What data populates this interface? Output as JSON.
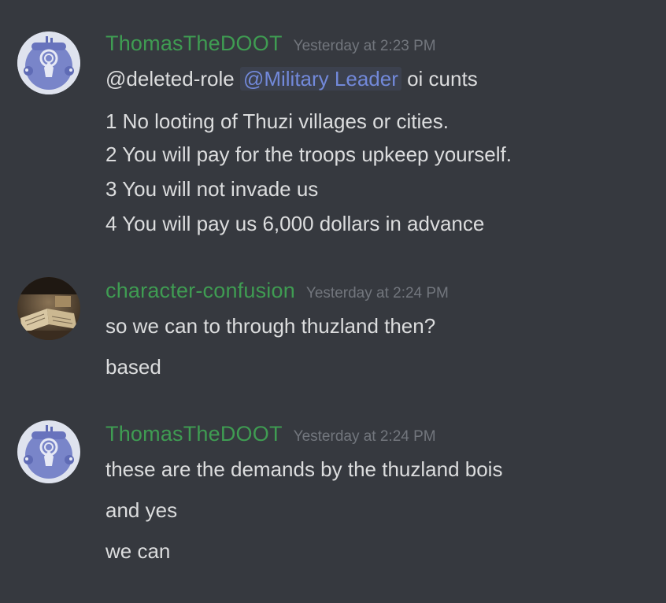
{
  "colors": {
    "background": "#36393f",
    "username": "#3f9c52",
    "timestamp": "#72767d",
    "message_text": "#dcddde",
    "mention": "#7289da"
  },
  "messages": [
    {
      "username": "ThomasTheDOOT",
      "timestamp": "Yesterday at 2:23 PM",
      "avatar": "robot-avatar-icon",
      "first_line": {
        "prefix": "@deleted-role",
        "mention": "@Military Leader",
        "suffix": "oi cunts"
      },
      "lines": [
        "1 No looting of Thuzi villages or cities.",
        "2 You will pay for the troops upkeep yourself.",
        "3 You will not invade us",
        "4 You will pay us 6,000 dollars in advance"
      ]
    },
    {
      "username": "character-confusion",
      "timestamp": "Yesterday at 2:24 PM",
      "avatar": "book-photo-avatar",
      "lines": [
        "so we can to through thuzland then?",
        "based"
      ]
    },
    {
      "username": "ThomasTheDOOT",
      "timestamp": "Yesterday at 2:24 PM",
      "avatar": "robot-avatar-icon",
      "lines": [
        "these are the demands by the thuzland bois",
        "and yes",
        "we can"
      ]
    }
  ]
}
